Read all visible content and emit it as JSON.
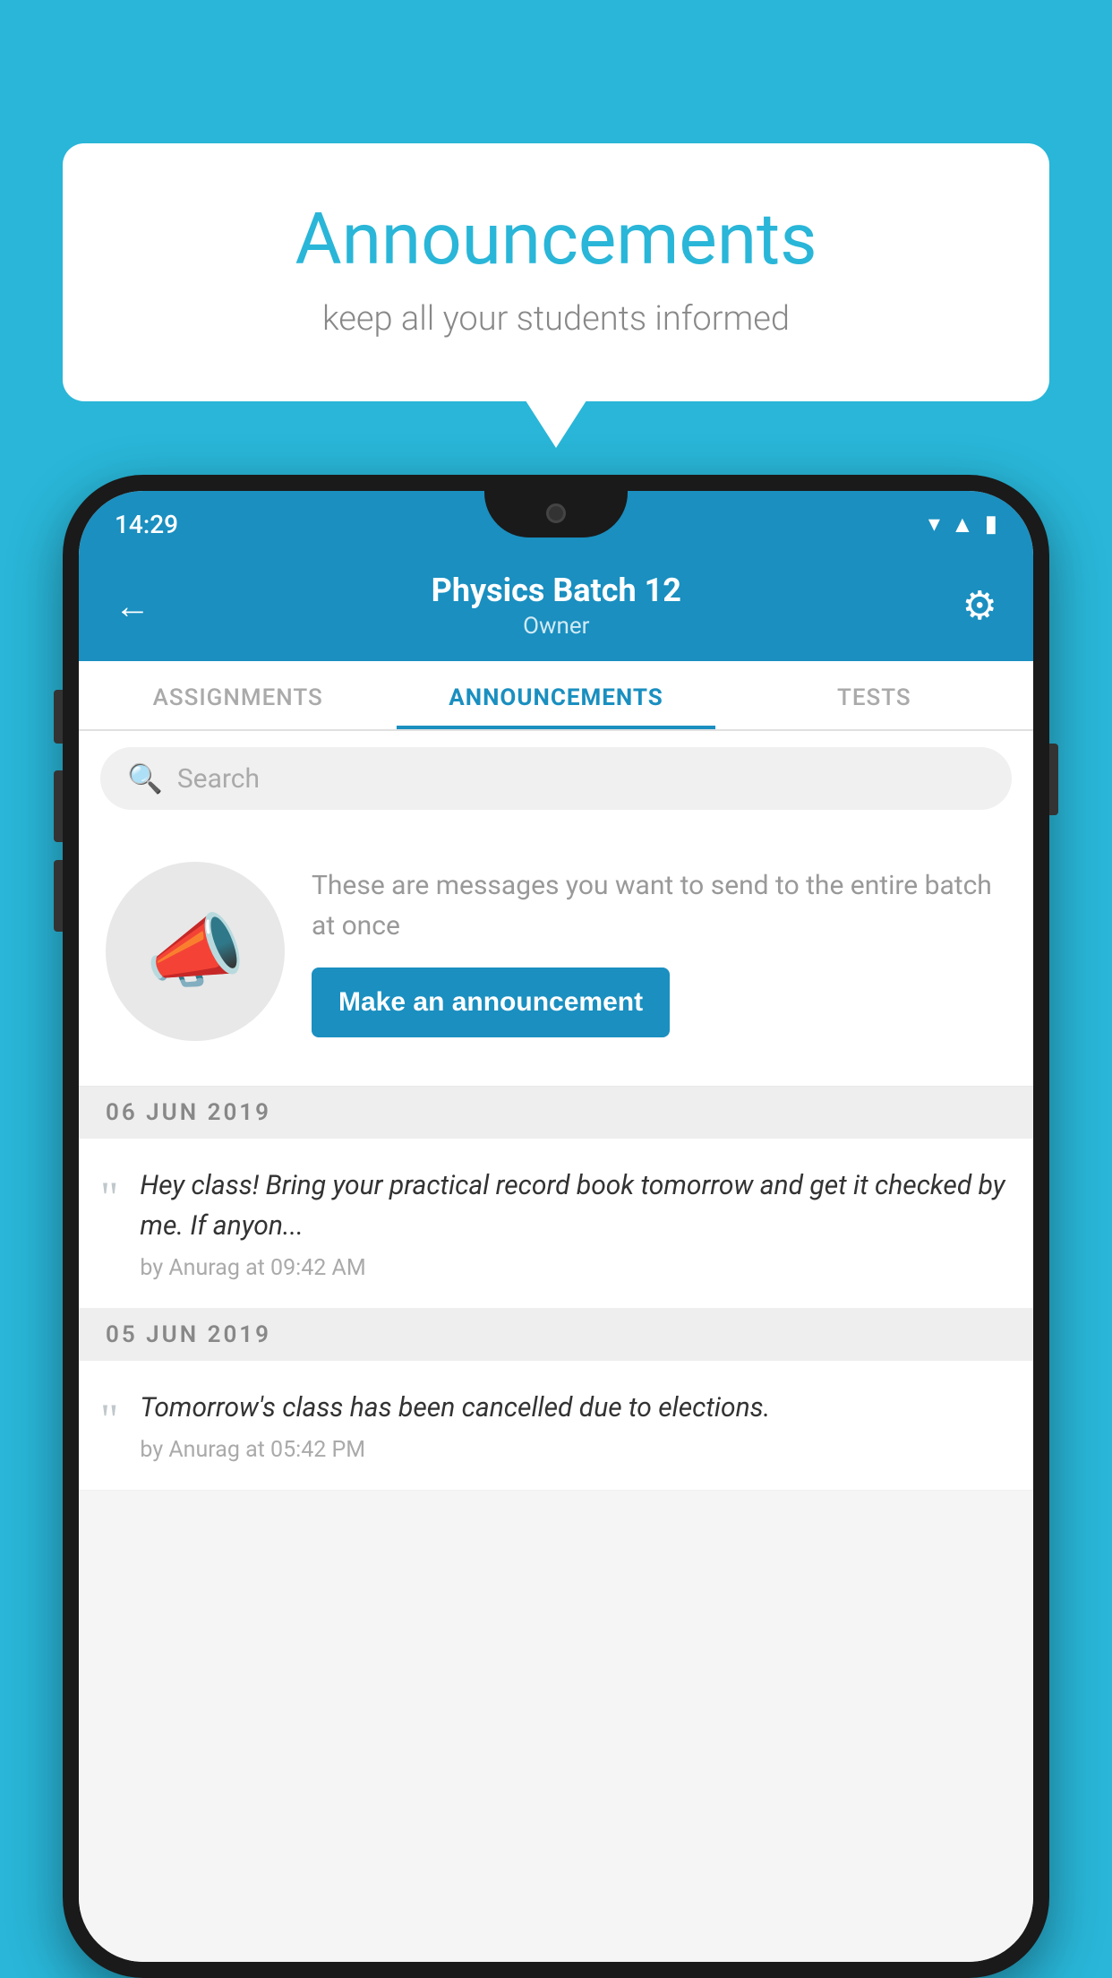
{
  "bubble": {
    "title": "Announcements",
    "subtitle": "keep all your students informed"
  },
  "phone": {
    "statusBar": {
      "time": "14:29",
      "icons": "▾◂▮"
    },
    "header": {
      "title": "Physics Batch 12",
      "subtitle": "Owner",
      "backArrow": "←",
      "gearIcon": "⚙"
    },
    "tabs": [
      {
        "label": "ASSIGNMENTS",
        "active": false
      },
      {
        "label": "ANNOUNCEMENTS",
        "active": true
      },
      {
        "label": "TESTS",
        "active": false
      }
    ],
    "search": {
      "placeholder": "Search"
    },
    "announcementPrompt": {
      "description": "These are messages you want to send to the entire batch at once",
      "buttonLabel": "Make an announcement"
    },
    "announcements": [
      {
        "date": "06  JUN  2019",
        "message": "Hey class! Bring your practical record book tomorrow and get it checked by me. If anyon...",
        "meta": "by Anurag at 09:42 AM"
      },
      {
        "date": "05  JUN  2019",
        "message": "Tomorrow's class has been cancelled due to elections.",
        "meta": "by Anurag at 05:42 PM"
      }
    ]
  }
}
